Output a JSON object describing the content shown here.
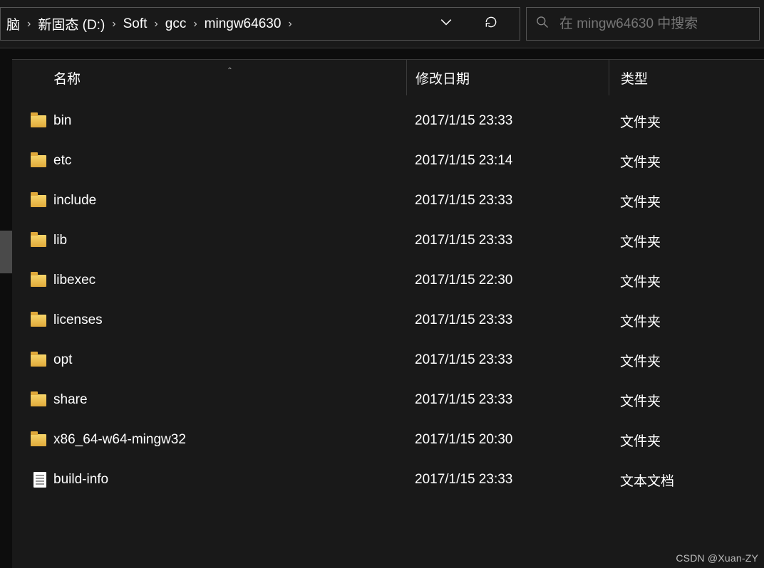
{
  "breadcrumbs": [
    "脑",
    "新固态 (D:)",
    "Soft",
    "gcc",
    "mingw64630"
  ],
  "search": {
    "placeholder": "在 mingw64630 中搜索"
  },
  "columns": {
    "name": "名称",
    "date": "修改日期",
    "type": "类型"
  },
  "items": [
    {
      "name": "bin",
      "date": "2017/1/15 23:33",
      "type": "文件夹",
      "kind": "folder"
    },
    {
      "name": "etc",
      "date": "2017/1/15 23:14",
      "type": "文件夹",
      "kind": "folder"
    },
    {
      "name": "include",
      "date": "2017/1/15 23:33",
      "type": "文件夹",
      "kind": "folder"
    },
    {
      "name": "lib",
      "date": "2017/1/15 23:33",
      "type": "文件夹",
      "kind": "folder"
    },
    {
      "name": "libexec",
      "date": "2017/1/15 22:30",
      "type": "文件夹",
      "kind": "folder"
    },
    {
      "name": "licenses",
      "date": "2017/1/15 23:33",
      "type": "文件夹",
      "kind": "folder"
    },
    {
      "name": "opt",
      "date": "2017/1/15 23:33",
      "type": "文件夹",
      "kind": "folder"
    },
    {
      "name": "share",
      "date": "2017/1/15 23:33",
      "type": "文件夹",
      "kind": "folder"
    },
    {
      "name": "x86_64-w64-mingw32",
      "date": "2017/1/15 20:30",
      "type": "文件夹",
      "kind": "folder"
    },
    {
      "name": "build-info",
      "date": "2017/1/15 23:33",
      "type": "文本文档",
      "kind": "file"
    }
  ],
  "watermark": "CSDN @Xuan-ZY"
}
